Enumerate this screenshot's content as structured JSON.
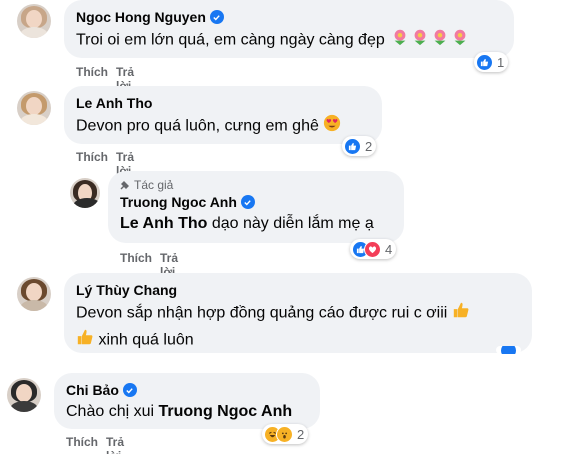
{
  "actions": {
    "like": "Thích",
    "reply": "Trả lời"
  },
  "author_tag": "Tác giả",
  "comments": [
    {
      "name": "Ngoc Hong Nguyen",
      "text": "Troi oi em lớn quá, em càng ngày càng đẹp",
      "reaction_count": "1",
      "reactions": [
        "like"
      ]
    },
    {
      "name": "Le Anh Tho",
      "text": "Devon pro quá luôn, cưng em ghê",
      "reaction_count": "2",
      "reactions": [
        "like"
      ]
    },
    {
      "name": "Truong Ngoc Anh",
      "mention": "Le Anh Tho",
      "text": "dạo này diễn lắm mẹ ạ",
      "reaction_count": "4",
      "reactions": [
        "like",
        "love"
      ]
    },
    {
      "name": "Lý Thùy Chang",
      "text_line1": "Devon sắp nhận hợp đồng quảng cáo được rui c ơiii",
      "text_line2": "xinh quá luôn"
    },
    {
      "name": "Chi Bảo",
      "text": "Chào chị xui",
      "mention": "Truong Ngoc Anh",
      "reaction_count": "2",
      "reactions": [
        "haha",
        "wow"
      ]
    }
  ]
}
